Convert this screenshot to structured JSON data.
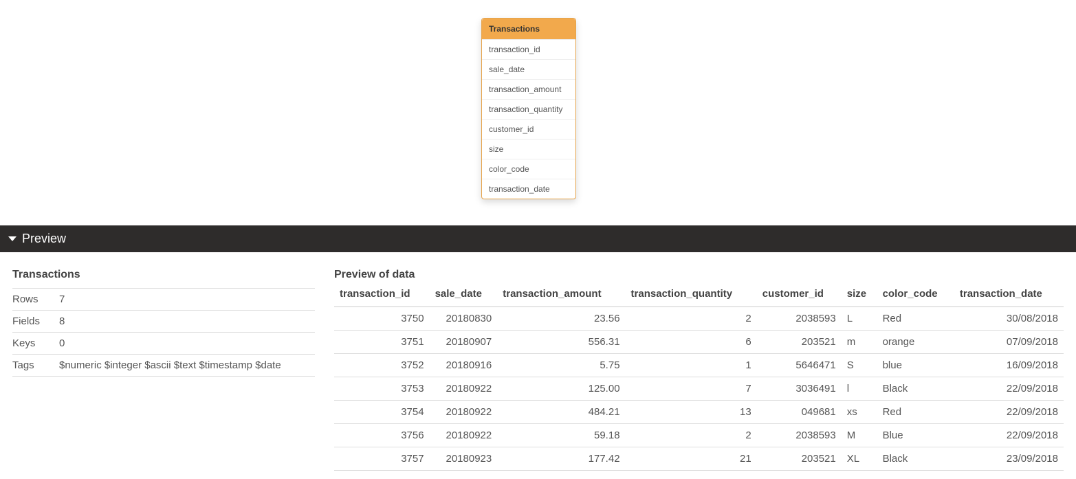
{
  "card": {
    "title": "Transactions",
    "fields": [
      "transaction_id",
      "sale_date",
      "transaction_amount",
      "transaction_quantity",
      "customer_id",
      "size",
      "color_code",
      "transaction_date"
    ]
  },
  "preview_bar": {
    "label": "Preview"
  },
  "meta": {
    "title": "Transactions",
    "rows_label": "Rows",
    "rows_value": "7",
    "fields_label": "Fields",
    "fields_value": "8",
    "keys_label": "Keys",
    "keys_value": "0",
    "tags_label": "Tags",
    "tags_value": "$numeric $integer $ascii $text $timestamp $date"
  },
  "data_preview": {
    "title": "Preview of data",
    "columns": [
      "transaction_id",
      "sale_date",
      "transaction_amount",
      "transaction_quantity",
      "customer_id",
      "size",
      "color_code",
      "transaction_date"
    ],
    "rows": [
      {
        "transaction_id": "3750",
        "sale_date": "20180830",
        "transaction_amount": "23.56",
        "transaction_quantity": "2",
        "customer_id": "2038593",
        "size": "L",
        "color_code": "Red",
        "transaction_date": "30/08/2018"
      },
      {
        "transaction_id": "3751",
        "sale_date": "20180907",
        "transaction_amount": "556.31",
        "transaction_quantity": "6",
        "customer_id": "203521",
        "size": "m",
        "color_code": "orange",
        "transaction_date": "07/09/2018"
      },
      {
        "transaction_id": "3752",
        "sale_date": "20180916",
        "transaction_amount": "5.75",
        "transaction_quantity": "1",
        "customer_id": "5646471",
        "size": "S",
        "color_code": "blue",
        "transaction_date": "16/09/2018"
      },
      {
        "transaction_id": "3753",
        "sale_date": "20180922",
        "transaction_amount": "125.00",
        "transaction_quantity": "7",
        "customer_id": "3036491",
        "size": "l",
        "color_code": "Black",
        "transaction_date": "22/09/2018"
      },
      {
        "transaction_id": "3754",
        "sale_date": "20180922",
        "transaction_amount": "484.21",
        "transaction_quantity": "13",
        "customer_id": "049681",
        "size": "xs",
        "color_code": "Red",
        "transaction_date": "22/09/2018"
      },
      {
        "transaction_id": "3756",
        "sale_date": "20180922",
        "transaction_amount": "59.18",
        "transaction_quantity": "2",
        "customer_id": "2038593",
        "size": "M",
        "color_code": "Blue",
        "transaction_date": "22/09/2018"
      },
      {
        "transaction_id": "3757",
        "sale_date": "20180923",
        "transaction_amount": "177.42",
        "transaction_quantity": "21",
        "customer_id": "203521",
        "size": "XL",
        "color_code": "Black",
        "transaction_date": "23/09/2018"
      }
    ]
  }
}
